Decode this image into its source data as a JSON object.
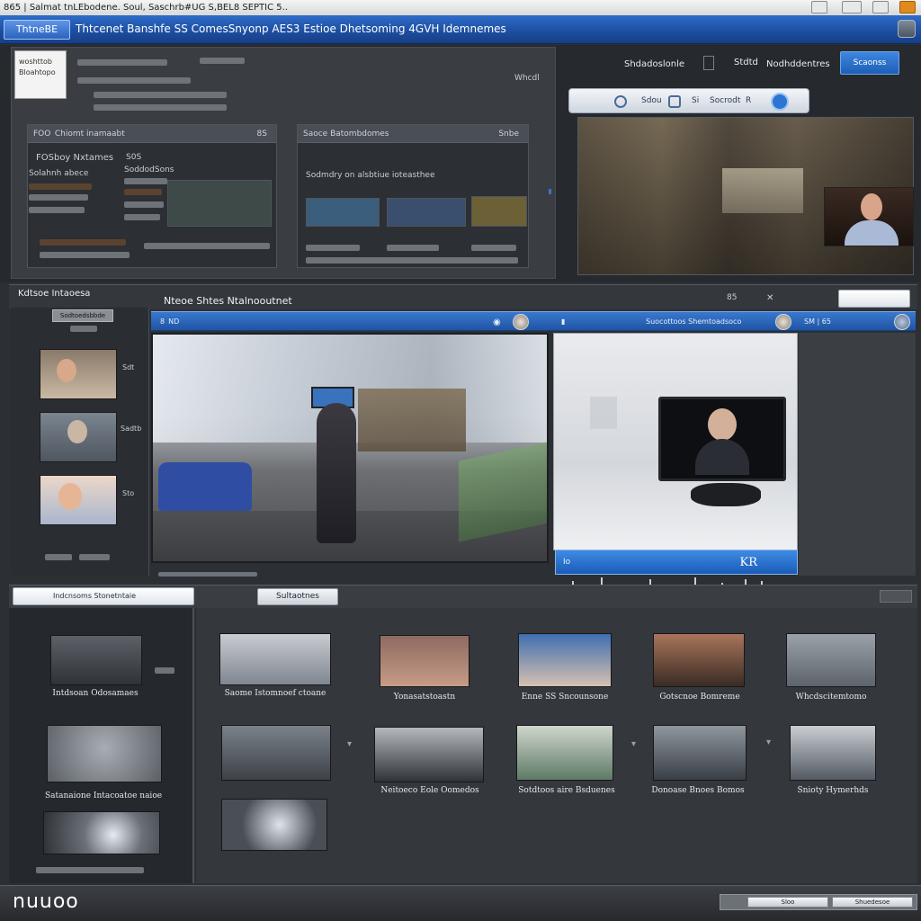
{
  "os_bar": {
    "title": "865 | Salmat tnLEbodene. Soul, Saschrb#UG S,BEL8 SEPTIC 5.."
  },
  "title_bar": {
    "logo_text": "ThtneBE",
    "title": "Thtcenet Banshfe SS ComesSnyonp AES3 Estioe Dhetsoming 4GVH Idemnemes"
  },
  "upper": {
    "card_title": "woshttob",
    "card_sub": "Bloahtopo",
    "left_subhead": "FOO Chiomt inamaabt",
    "left_subhead_right": "8S",
    "left_heading": "FOSboy Nxtames",
    "left_heading_num": "S0S",
    "left_row1": "Solahnh abece",
    "left_row1_b": "SoddodSons",
    "mid_subhead": "Saoce Batombdomes",
    "mid_subhead_right": "Snbe",
    "mid_label": "Sodmdry on alsbtiue ioteasthee",
    "wmark": "Whcdl",
    "header_label": "Shdadoslonle",
    "header_label2": "Stdtd",
    "header_label3": "Nodhddentres",
    "blue_button": "Scaonss",
    "pill_labels": [
      "Sdou",
      "Si",
      "Socrodt",
      "R"
    ]
  },
  "middle": {
    "left_title": "Kdtsoe Intaoesa",
    "title": "Nteoe Shtes Ntalnooutnet",
    "left_button": "Sodtoedsbbde",
    "page_indicator": "85",
    "strip_left": "8 ND",
    "strip_right": "Suocottoos Shemtoadsoco",
    "strip_far": "SM | 65",
    "side_page": "Io",
    "side_label": "KR",
    "left_captions": [
      "Sdt",
      "Sadtb",
      "Sto"
    ]
  },
  "lower": {
    "search_placeholder": "Indcnsoms Stonetntaie",
    "button": "Sultaotnes",
    "captions_row1": [
      "Intdsoan Odosamaes",
      "Saome Istomnoef ctoane",
      "Yonasatstoastn",
      "Enne SS Sncounsone",
      "Gotscnoe Bomreme",
      "Whcdscitemtomo"
    ],
    "captions_row2": [
      "Satanaione Intacoatoe naioe",
      "Neitoeco Eole Oomedos",
      "Sotdtoos aire Bsduenes",
      "Donoase Bnoes Bomos",
      "Snioty Hymerhds"
    ]
  },
  "bottom": {
    "brand": "nuuoo",
    "btn1": "Sloo",
    "btn2": "Shuedesoe"
  },
  "colors": {
    "accent_blue": "#1f5cb6",
    "title_bar": "#1c4d9f",
    "background": "#2c2f34"
  }
}
